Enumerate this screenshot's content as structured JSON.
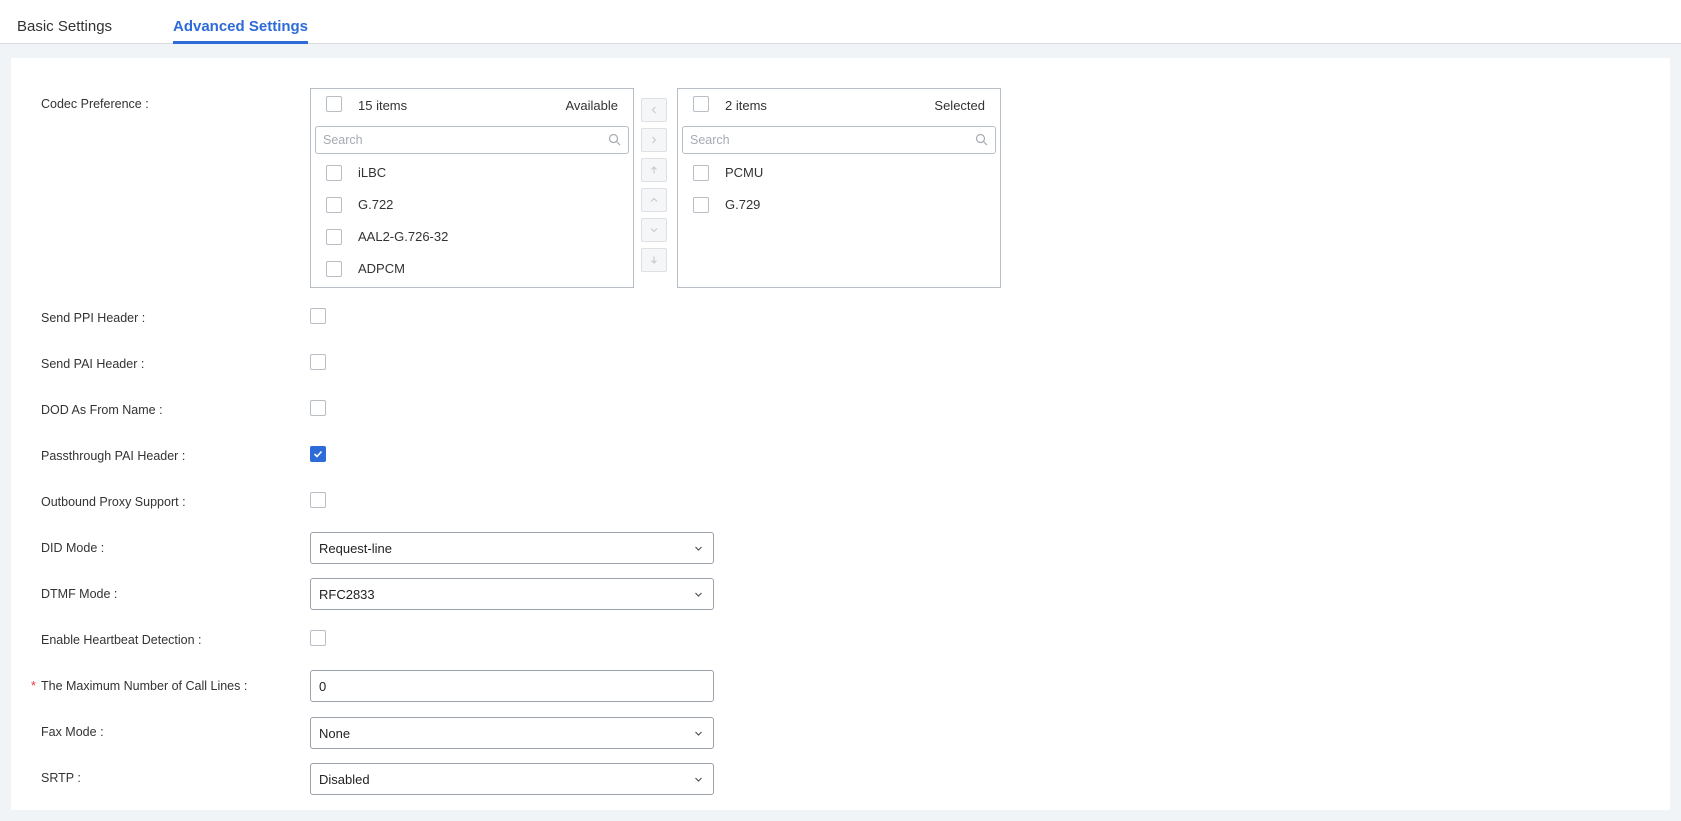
{
  "tabs": [
    {
      "label": "Basic Settings",
      "active": false
    },
    {
      "label": "Advanced Settings",
      "active": true
    }
  ],
  "codec": {
    "label": "Codec Preference",
    "available": {
      "count": "15 items",
      "title": "Available",
      "search_placeholder": "Search",
      "items": [
        "iLBC",
        "G.722",
        "AAL2-G.726-32",
        "ADPCM"
      ]
    },
    "selected": {
      "count": "2 items",
      "title": "Selected",
      "search_placeholder": "Search",
      "items": [
        "PCMU",
        "G.729"
      ]
    },
    "buttons": [
      "move-left",
      "move-right",
      "move-top",
      "move-up",
      "move-down",
      "move-bottom"
    ]
  },
  "fields": {
    "send_ppi": {
      "label": "Send PPI Header",
      "checked": false
    },
    "send_pai": {
      "label": "Send PAI Header",
      "checked": false
    },
    "dod_from_name": {
      "label": "DOD As From Name",
      "checked": false
    },
    "passthrough_pai": {
      "label": "Passthrough PAI Header",
      "checked": true
    },
    "outbound_proxy": {
      "label": "Outbound Proxy Support",
      "checked": false
    },
    "did_mode": {
      "label": "DID Mode",
      "value": "Request-line"
    },
    "dtmf_mode": {
      "label": "DTMF Mode",
      "value": "RFC2833"
    },
    "heartbeat": {
      "label": "Enable Heartbeat Detection",
      "checked": false
    },
    "max_call_lines": {
      "label": "The Maximum Number of Call Lines",
      "value": "0",
      "required_mark": "*"
    },
    "fax_mode": {
      "label": "Fax Mode",
      "value": "None"
    },
    "srtp": {
      "label": "SRTP",
      "value": "Disabled"
    }
  },
  "colors": {
    "accent": "#2d6bd9",
    "required": "#e5393c"
  }
}
